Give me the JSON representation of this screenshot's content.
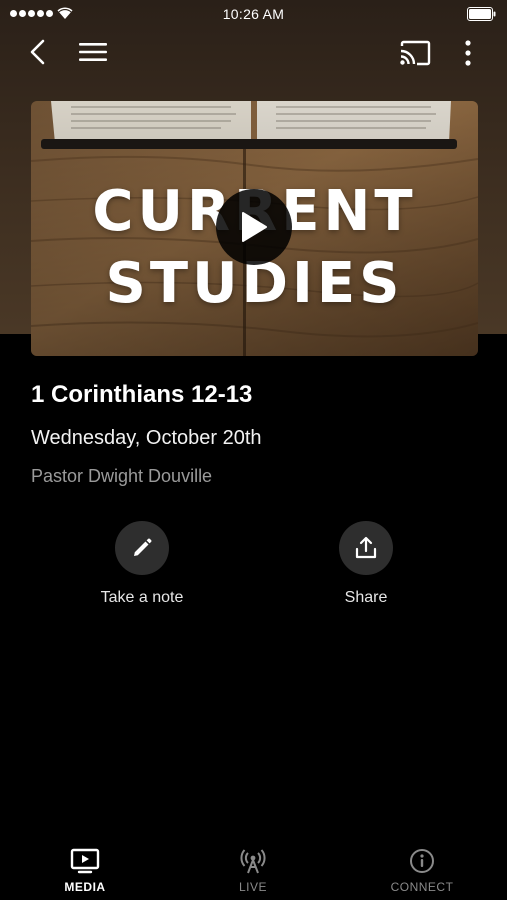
{
  "status_bar": {
    "time": "10:26 AM"
  },
  "hero": {
    "line1": "CURRENT",
    "line2": "STUDIES"
  },
  "sermon": {
    "title": "1 Corinthians 12-13",
    "date": "Wednesday, October 20th",
    "speaker": "Pastor Dwight Douville"
  },
  "actions": {
    "note_label": "Take a note",
    "share_label": "Share"
  },
  "tabs": {
    "media": "MEDIA",
    "live": "LIVE",
    "connect": "CONNECT"
  },
  "icons": {
    "back": "chevron-left-icon",
    "menu": "hamburger-icon",
    "cast": "cast-icon",
    "more": "more-vertical-icon",
    "play": "play-icon",
    "note": "pencil-icon",
    "share": "share-icon",
    "media": "tv-icon",
    "live": "broadcast-icon",
    "connect": "info-icon"
  },
  "colors": {
    "background": "#000000",
    "header": "#3d2e20",
    "active_tab": "#ffffff",
    "inactive_tab": "#8a8a8a",
    "speaker_text": "#9a9a9a"
  }
}
